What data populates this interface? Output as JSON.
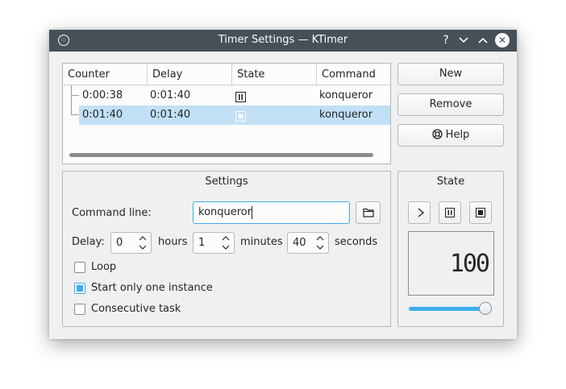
{
  "window": {
    "title": "Timer Settings — KTimer",
    "help_glyph": "?",
    "minimize_glyph": "⌄",
    "maximize_glyph": "⌃",
    "close_glyph": "✕"
  },
  "table": {
    "columns": [
      "Counter",
      "Delay",
      "State",
      "Command"
    ],
    "rows": [
      {
        "counter": "0:00:38",
        "delay": "0:01:40",
        "state": "pause-icon",
        "command": "konqueror",
        "selected": false
      },
      {
        "counter": "0:01:40",
        "delay": "0:01:40",
        "state": "stop-icon",
        "command": "konqueror",
        "selected": true
      }
    ]
  },
  "buttons": {
    "new": "New",
    "remove": "Remove",
    "help": "Help"
  },
  "settings": {
    "title": "Settings",
    "command_label": "Command line:",
    "command_value": "konqueror",
    "delay_label": "Delay:",
    "hours_value": "0",
    "hours_label": "hours",
    "minutes_value": "1",
    "minutes_label": "minutes",
    "seconds_value": "40",
    "seconds_label": "seconds",
    "loop_label": "Loop",
    "loop_checked": false,
    "one_instance_label": "Start only one instance",
    "one_instance_checked": true,
    "consecutive_label": "Consecutive task",
    "consecutive_checked": false
  },
  "state": {
    "title": "State",
    "display_value": "100",
    "slider_fraction": 1.0
  },
  "colors": {
    "accent": "#3daee9",
    "titlebar": "#475057",
    "selection": "#c2e0f5"
  }
}
